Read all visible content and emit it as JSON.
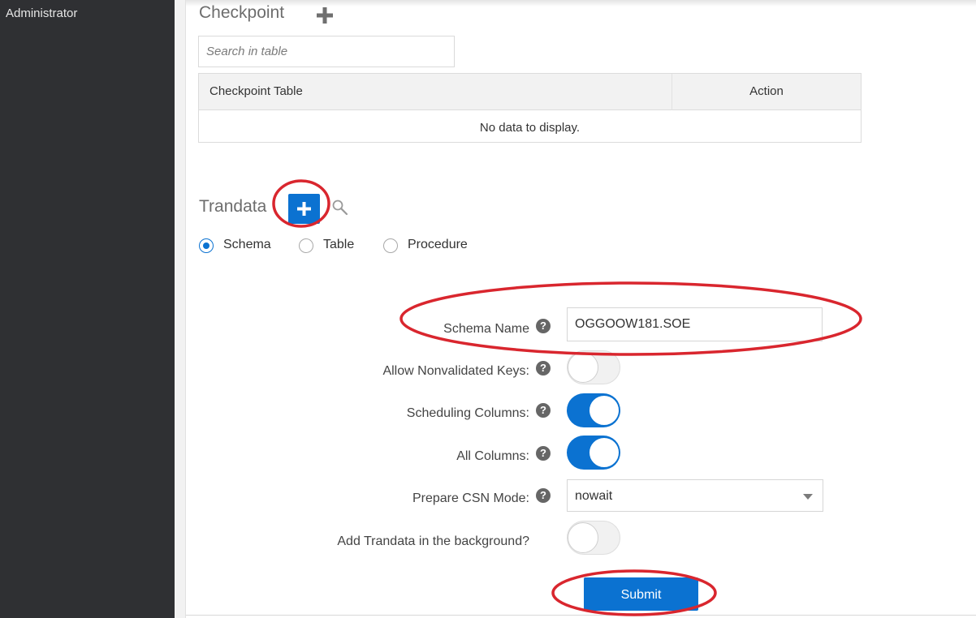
{
  "sidebar": {
    "label": "Administrator"
  },
  "checkpoint": {
    "title": "Checkpoint",
    "add_icon": "plus-icon",
    "search_placeholder": "Search in table",
    "table": {
      "columns": [
        "Checkpoint Table",
        "Action"
      ],
      "empty_message": "No data to display."
    }
  },
  "trandata": {
    "title": "Trandata",
    "add_icon": "plus-icon",
    "search_icon": "magnifier-icon",
    "radios": [
      {
        "label": "Schema",
        "checked": true
      },
      {
        "label": "Table",
        "checked": false
      },
      {
        "label": "Procedure",
        "checked": false
      }
    ],
    "form": {
      "schema_name": {
        "label": "Schema Name",
        "value": "OGGOOW181.SOE"
      },
      "allow_nonvalidated_keys": {
        "label": "Allow Nonvalidated Keys:",
        "on": false
      },
      "scheduling_columns": {
        "label": "Scheduling Columns:",
        "on": true
      },
      "all_columns": {
        "label": "All Columns:",
        "on": true
      },
      "prepare_csn_mode": {
        "label": "Prepare CSN Mode:",
        "value": "nowait"
      },
      "add_in_background": {
        "label": "Add Trandata in the background?",
        "on": false
      }
    },
    "submit_label": "Submit"
  },
  "help_icon": "?",
  "colors": {
    "accent": "#0b72d1",
    "sidebar_bg": "#2f3033",
    "annotation": "#d9262e"
  }
}
